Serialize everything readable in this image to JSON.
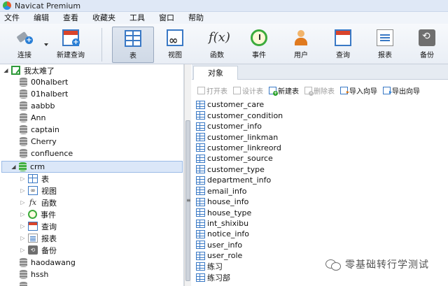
{
  "window": {
    "title": "Navicat Premium"
  },
  "menu": [
    "文件",
    "编辑",
    "查看",
    "收藏夹",
    "工具",
    "窗口",
    "帮助"
  ],
  "toolbar": {
    "connect": "连接",
    "new_query": "新建查询",
    "table": "表",
    "view": "视图",
    "function": "函数",
    "event": "事件",
    "user": "用户",
    "query": "查询",
    "report": "报表",
    "backup": "备份",
    "function_glyph": "f(x)",
    "active": "table"
  },
  "tree": {
    "connection": "我太难了",
    "databases_before": [
      "00halbert",
      "01halbert",
      "aabbb",
      "Ann",
      "captain",
      "Cherry",
      "confluence"
    ],
    "selected_db": "crm",
    "crm_children": [
      "表",
      "视图",
      "函数",
      "事件",
      "查询",
      "报表",
      "备份"
    ],
    "databases_after": [
      "haodawang",
      "hssh"
    ]
  },
  "tabs": {
    "objects": "对象"
  },
  "object_toolbar": {
    "open_table": "打开表",
    "design_table": "设计表",
    "new_table": "新建表",
    "delete_table": "删除表",
    "import_wizard": "导入向导",
    "export_wizard": "导出向导"
  },
  "objects": [
    "customer_care",
    "customer_condition",
    "customer_info",
    "customer_linkman",
    "customer_linkreord",
    "customer_source",
    "customer_type",
    "department_info",
    "email_info",
    "house_info",
    "house_type",
    "int_shixibu",
    "notice_info",
    "user_info",
    "user_role",
    "练习",
    "练习部"
  ],
  "watermark": "零基础转行学测试"
}
